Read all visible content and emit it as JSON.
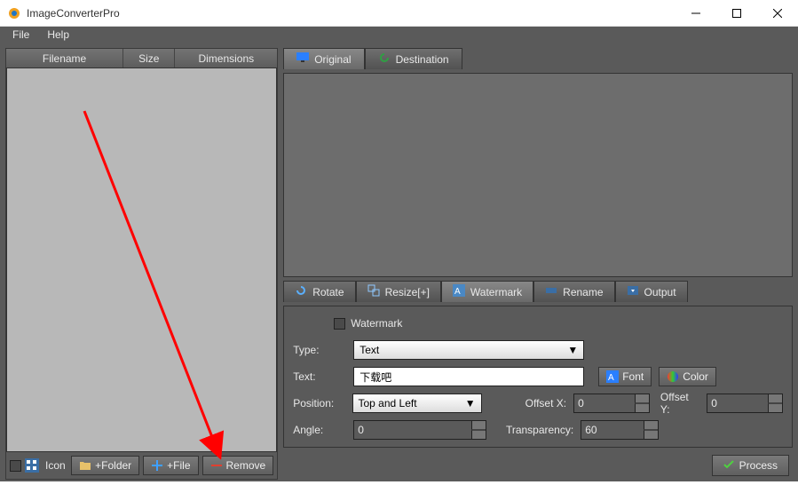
{
  "app": {
    "title": "ImageConverterPro"
  },
  "menu": {
    "file": "File",
    "help": "Help"
  },
  "fileList": {
    "headers": {
      "filename": "Filename",
      "size": "Size",
      "dimensions": "Dimensions"
    }
  },
  "leftBottom": {
    "iconLabel": "Icon",
    "addFolder": "+Folder",
    "addFile": "+File",
    "remove": "Remove"
  },
  "previewTabs": {
    "original": "Original",
    "destination": "Destination"
  },
  "toolTabs": {
    "rotate": "Rotate",
    "resize": "Resize[+]",
    "watermark": "Watermark",
    "rename": "Rename",
    "output": "Output"
  },
  "watermarkPanel": {
    "enableLabel": "Watermark",
    "typeLabel": "Type:",
    "typeValue": "Text",
    "textLabel": "Text:",
    "textValue": "下载吧",
    "fontBtn": "Font",
    "colorBtn": "Color",
    "positionLabel": "Position:",
    "positionValue": "Top and Left",
    "offsetXLabel": "Offset X:",
    "offsetXValue": "0",
    "offsetYLabel": "Offset Y:",
    "offsetYValue": "0",
    "angleLabel": "Angle:",
    "angleValue": "0",
    "transparencyLabel": "Transparency:",
    "transparencyValue": "60"
  },
  "process": {
    "label": "Process"
  }
}
